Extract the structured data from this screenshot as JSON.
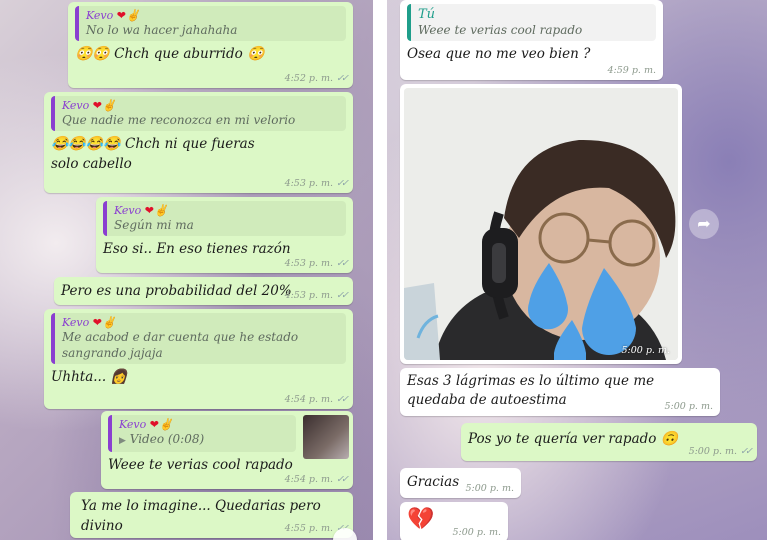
{
  "left": {
    "messages": [
      {
        "quote_name": "Kevo",
        "quote_text": "No lo wa hacer jahahaha",
        "text": "Chch que aburrido",
        "time": "4:52 p. m."
      },
      {
        "quote_name": "Kevo",
        "quote_text": "Que nadie me reconozca en mi velorio",
        "text": "Chch ni que fueras solo cabello",
        "time": "4:53 p. m."
      },
      {
        "quote_name": "Kevo",
        "quote_text": "Según mi ma",
        "text": "Eso si.. En eso tienes razón",
        "time": "4:53 p. m."
      },
      {
        "text": "Pero es una probabilidad del 20%",
        "time": "4:53 p. m."
      },
      {
        "quote_name": "Kevo",
        "quote_text": "Me acabod e dar cuenta que he estado sangrando jajaja",
        "text": "Uhhta...",
        "time": "4:54 p. m."
      },
      {
        "quote_name": "Kevo",
        "quote_text": "Video (0:08)",
        "text": "Weee te verias cool rapado",
        "time": "4:54 p. m."
      },
      {
        "text": "Ya me lo imagine... Quedarias pero divino",
        "time": "4:55 p. m."
      }
    ]
  },
  "right": {
    "messages": [
      {
        "quote_name": "Tú",
        "quote_text": "Weee te verias cool rapado",
        "text": "Osea que no me veo bien ?",
        "time": "4:59 p. m."
      },
      {
        "photo_time": "5:00 p. m."
      },
      {
        "text": "Esas 3 lágrimas es lo último que me quedaba de autoestima",
        "time": "5:00 p. m."
      },
      {
        "text": "Pos yo te quería ver rapado",
        "time": "5:00 p. m."
      },
      {
        "text": "Gracias",
        "time": "5:00 p. m."
      },
      {
        "text": "",
        "time": "5:00 p. m."
      }
    ]
  },
  "icons": {
    "ticks": "✓✓",
    "heart": "❤",
    "victory": "✌",
    "video_camera": "▶",
    "forward": "➦",
    "scroll_down": "⌄"
  },
  "colors": {
    "outgoing_bubble": "#dcf8c6",
    "incoming_bubble": "#ffffff",
    "quote_name_purple": "#8a3fd0",
    "quote_name_teal": "#1f9e8b",
    "tear_blue": "#4fa0e6",
    "broken_heart": "#e0102a"
  }
}
